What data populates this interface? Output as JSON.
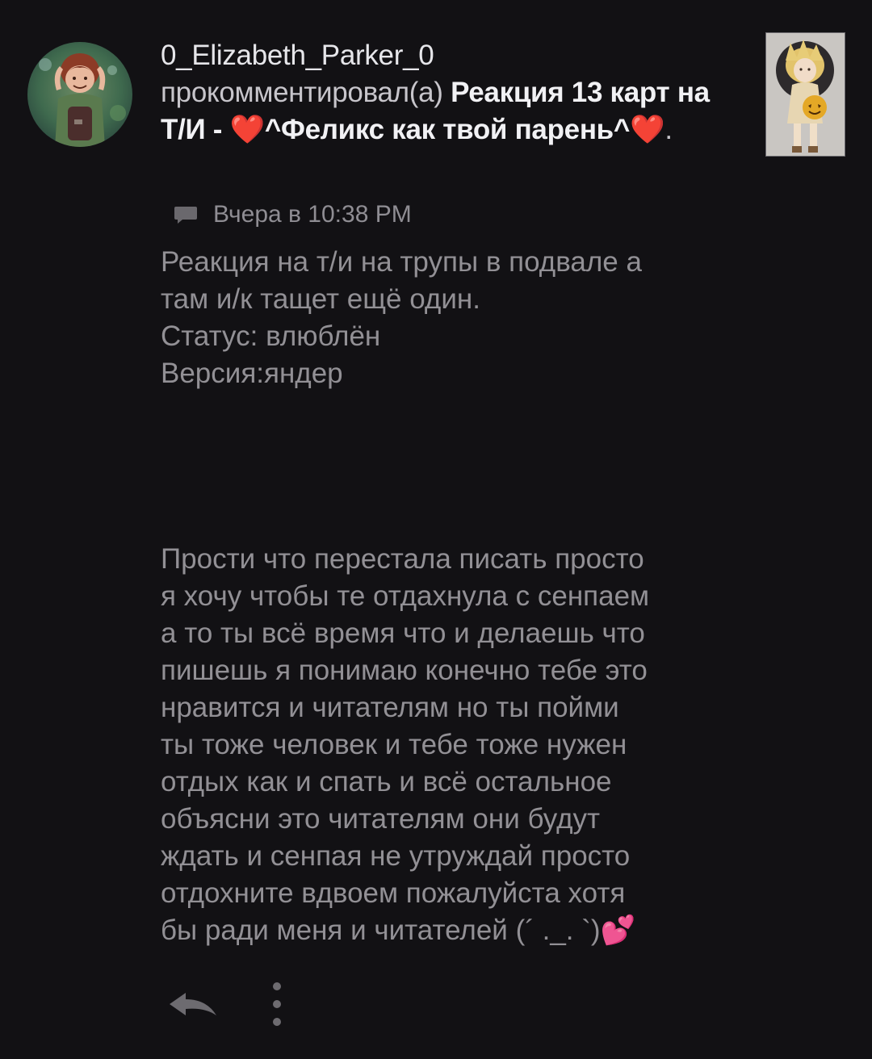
{
  "comment": {
    "author": "0_Elizabeth_Parker_0",
    "action": "прокомментировал(а)",
    "post_title_prefix": "Реакция 13 карт на Т/И - ",
    "post_title_heart1": "❤️",
    "post_title_middle": "^Феликс как твой парень^",
    "post_title_heart2": "❤️",
    "post_title_end": ".",
    "timestamp": "Вчера в 10:38 PM",
    "text_part1": "Реакция на т/и на трупы в подвале а\nтам и/к тащет ещё один.\nСтатус: влюблён\nВерсия:яндер",
    "text_part2": "Прости что перестала писать просто\nя хочу чтобы те отдахнула с сенпаем\nа то ты всё время что и делаешь что\nпишешь я понимаю конечно тебе это\nнравится и читателям но ты пойми\nты тоже человек и тебе тоже нужен\nотдых как и спать и всё остальное\nобъясни это читателям они будут\nждать и сенпая не утруждай просто\nотдохните вдвоем пожалуйста хотя\nбы ради меня и читателей (´ ._. `)💕"
  },
  "icons": {
    "avatar": "user-avatar",
    "thumbnail": "post-thumbnail",
    "timestamp": "comment-bubble-icon",
    "reply": "reply-arrow-icon",
    "more": "vertical-dots-icon"
  },
  "colors": {
    "background": "#121114",
    "heart": "#d62c2c",
    "title": "#f1f1f4",
    "text": "#929095"
  }
}
